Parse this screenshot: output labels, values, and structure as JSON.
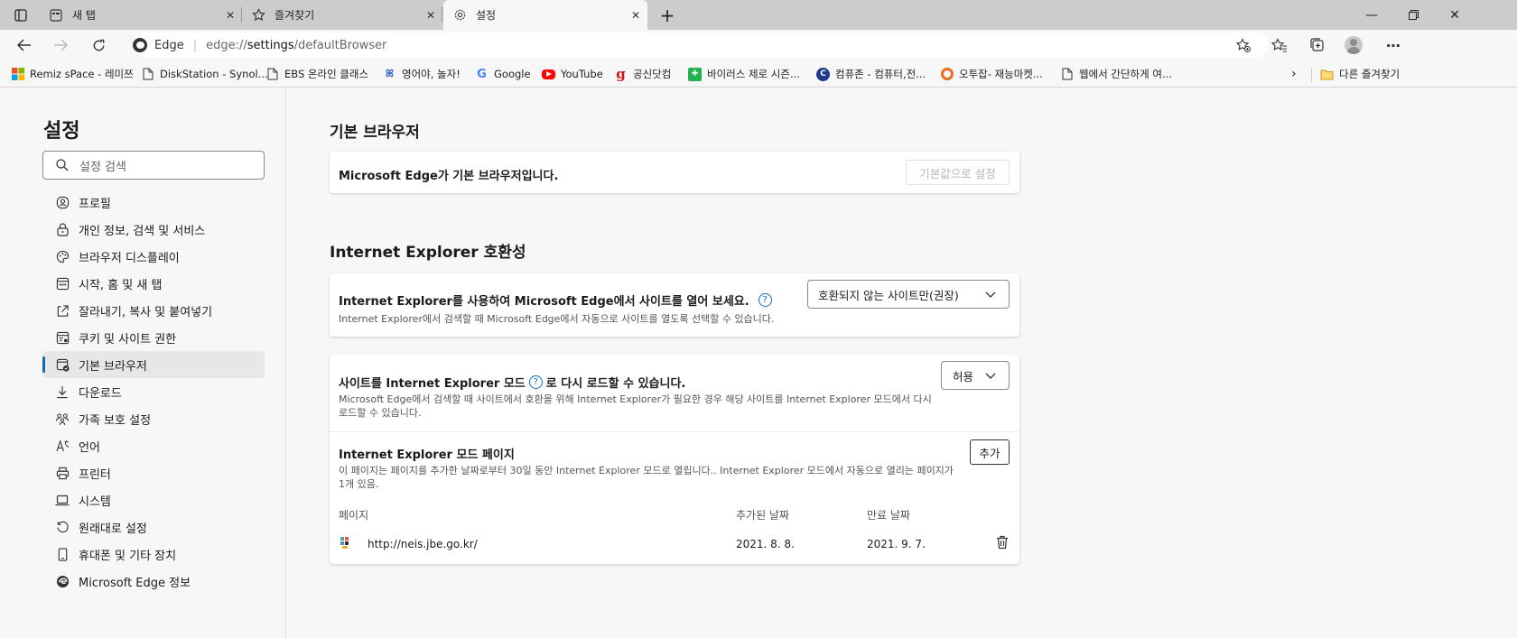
{
  "tabs": [
    {
      "label": "새 탭",
      "icon": "new-tab-icon"
    },
    {
      "label": "즐겨찾기",
      "icon": "star-icon"
    },
    {
      "label": "설정",
      "icon": "gear-icon"
    }
  ],
  "new_tab_symbol": "+",
  "omnibox": {
    "site": "Edge",
    "url_prefix": "edge://",
    "url_bold": "settings",
    "url_rest": "/defaultBrowser"
  },
  "bookmarks": [
    {
      "label": "Remiz sPace - 레미쯔",
      "icon": "windows-icon"
    },
    {
      "label": "DiskStation - Synol...",
      "icon": "page-icon"
    },
    {
      "label": "EBS 온라인 클래스",
      "icon": "page-icon"
    },
    {
      "label": "영어야, 놀자!",
      "icon": "site-icon"
    },
    {
      "label": "Google",
      "icon": "google-icon"
    },
    {
      "label": "YouTube",
      "icon": "youtube-icon"
    },
    {
      "label": "공신닷컴",
      "icon": "gongsin-icon"
    },
    {
      "label": "바이러스 제로 시즌...",
      "icon": "virus-icon"
    },
    {
      "label": "컴퓨존 - 컴퓨터,전...",
      "icon": "compuzone-icon"
    },
    {
      "label": "오투잡- 재능마켓...",
      "icon": "otwojob-icon"
    },
    {
      "label": "웹에서 간단하게 여...",
      "icon": "page-icon"
    }
  ],
  "other_favorites": "다른 즐겨찾기",
  "sidebar": {
    "title": "설정",
    "search_placeholder": "설정 검색",
    "items": [
      {
        "label": "프로필",
        "icon": "profile-icon"
      },
      {
        "label": "개인 정보, 검색 및 서비스",
        "icon": "lock-icon"
      },
      {
        "label": "브라우저 디스플레이",
        "icon": "palette-icon"
      },
      {
        "label": "시작, 홈 및 새 탭",
        "icon": "home-grid-icon"
      },
      {
        "label": "잘라내기, 복사 및 붙여넣기",
        "icon": "share-icon"
      },
      {
        "label": "쿠키 및 사이트 권한",
        "icon": "cookie-icon"
      },
      {
        "label": "기본 브라우저",
        "icon": "browser-check-icon",
        "selected": true
      },
      {
        "label": "다운로드",
        "icon": "download-icon"
      },
      {
        "label": "가족 보호 설정",
        "icon": "family-icon"
      },
      {
        "label": "언어",
        "icon": "language-icon"
      },
      {
        "label": "프린터",
        "icon": "printer-icon"
      },
      {
        "label": "시스템",
        "icon": "laptop-icon"
      },
      {
        "label": "원래대로 설정",
        "icon": "reset-icon"
      },
      {
        "label": "휴대폰 및 기타 장치",
        "icon": "phone-icon"
      },
      {
        "label": "Microsoft Edge 정보",
        "icon": "edge-icon"
      }
    ]
  },
  "main": {
    "default_browser": {
      "heading": "기본 브라우저",
      "status": "Microsoft Edge가 기본 브라우저입니다.",
      "button": "기본값으로 설정"
    },
    "ie_compat": {
      "heading": "Internet Explorer 호환성",
      "open_title": "Internet Explorer를 사용하여 Microsoft Edge에서 사이트를 열어 보세요.",
      "open_desc": "Internet Explorer에서 검색할 때 Microsoft Edge에서 자동으로 사이트를 열도록 선택할 수 있습니다.",
      "open_value": "호환되지 않는 사이트만(권장)",
      "reload_title_a": "사이트를 Internet Explorer 모드",
      "reload_title_b": "로 다시 로드할 수 있습니다.",
      "reload_desc": "Microsoft Edge에서 검색할 때 사이트에서 호환을 위해 Internet Explorer가 필요한 경우 해당 사이트를 Internet Explorer 모드에서 다시 로드할 수 있습니다.",
      "reload_value": "허용",
      "pages_title": "Internet Explorer 모드 페이지",
      "pages_desc": "이 페이지는 페이지를 추가한 날짜로부터 30일 동안 Internet Explorer 모드로 열립니다.. Internet Explorer 모드에서 자동으로 열리는 페이지가 1개 있음.",
      "add_button": "추가",
      "columns": [
        "페이지",
        "추가된 날짜",
        "만료 날짜"
      ],
      "rows": [
        {
          "url": "http://neis.jbe.go.kr/",
          "added": "2021. 8. 8.",
          "expires": "2021. 9. 7."
        }
      ]
    }
  },
  "help_symbol": "?",
  "colors": {
    "accent": "#0f6cbd",
    "youtube": "#ff0000",
    "google": "#4285f4"
  }
}
